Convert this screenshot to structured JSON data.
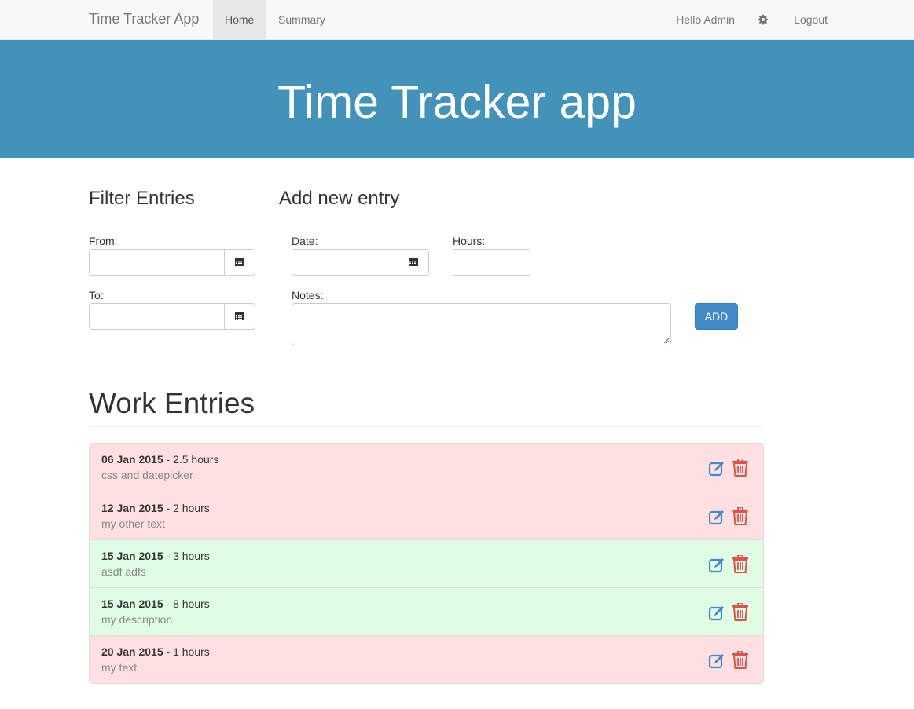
{
  "navbar": {
    "brand": "Time Tracker App",
    "home": "Home",
    "summary": "Summary",
    "hello": "Hello Admin",
    "gear_icon": "gear-icon",
    "logout": "Logout"
  },
  "hero": {
    "title": "Time Tracker app"
  },
  "filter": {
    "heading": "Filter Entries",
    "from_label": "From:",
    "to_label": "To:",
    "from_value": "",
    "to_value": ""
  },
  "add_entry": {
    "heading": "Add new entry",
    "date_label": "Date:",
    "hours_label": "Hours:",
    "notes_label": "Notes:",
    "button": "ADD"
  },
  "work_entries": {
    "heading": "Work Entries",
    "items": [
      {
        "date": "06 Jan 2015",
        "hours": " - 2.5 hours",
        "note": "css and datepicker",
        "status": "bad"
      },
      {
        "date": "12 Jan 2015",
        "hours": " - 2 hours",
        "note": "my other text",
        "status": "bad"
      },
      {
        "date": "15 Jan 2015",
        "hours": " - 3 hours",
        "note": "asdf adfs",
        "status": "good"
      },
      {
        "date": "15 Jan 2015",
        "hours": " - 8 hours",
        "note": "my description",
        "status": "good"
      },
      {
        "date": "20 Jan 2015",
        "hours": " - 1 hours",
        "note": "my text",
        "status": "bad"
      }
    ]
  },
  "colors": {
    "hero": "#4292b9",
    "entry_bad": "#fee0e0",
    "entry_good": "#e0fde3",
    "button": "#428bca",
    "edit_icon": "#428bca",
    "trash_icon": "#d9534f"
  }
}
